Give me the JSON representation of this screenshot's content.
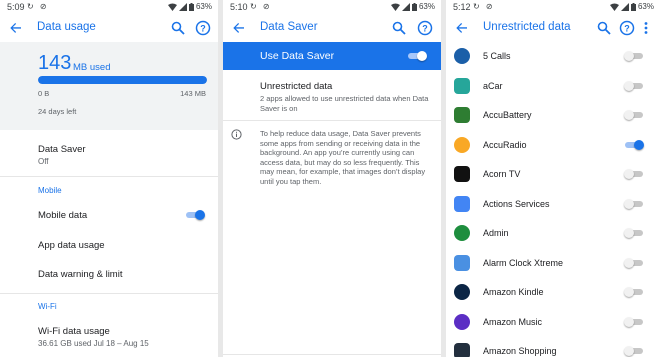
{
  "colors": {
    "accent": "#1a73e8",
    "bar_track": "#dadce0",
    "card": "#f1f3f4"
  },
  "status": [
    {
      "time": "5:09",
      "icons": "↻ ⊘",
      "battery": "63%"
    },
    {
      "time": "5:10",
      "icons": "↻ ⊘",
      "battery": "63%"
    },
    {
      "time": "5:12",
      "icons": "↻ ⊘",
      "battery": "63%"
    }
  ],
  "data_usage": {
    "title": "Data usage",
    "amount": "143",
    "unit": "MB used",
    "progress_fraction": 1.0,
    "range_min": "0 B",
    "range_max": "143 MB",
    "days_left": "24 days left",
    "items": [
      {
        "label": "Data Saver",
        "sub": "Off"
      },
      {
        "section": "Mobile"
      },
      {
        "label": "Mobile data",
        "toggle": true
      },
      {
        "label": "App data usage"
      },
      {
        "label": "Data warning & limit"
      },
      {
        "section": "Wi-Fi"
      },
      {
        "label": "Wi-Fi data usage",
        "sub": "36.61 GB used Jul 18 – Aug 15"
      }
    ]
  },
  "data_saver": {
    "title": "Data Saver",
    "use_label": "Use Data Saver",
    "use_on": true,
    "unrestricted_title": "Unrestricted data",
    "unrestricted_sub": "2 apps allowed to use unrestricted data when Data Saver is on",
    "info": "To help reduce data usage, Data Saver prevents some apps from sending or receiving data in the background. An app you’re currently using can access data, but may do so less frequently. This may mean, for example, that images don’t display until you tap them."
  },
  "unrestricted": {
    "title": "Unrestricted data",
    "apps": [
      {
        "name": "5 Calls",
        "on": false,
        "icon": "five-calls-icon",
        "color": "#1b5fa8"
      },
      {
        "name": "aCar",
        "on": false,
        "icon": "acar-icon",
        "color": "#26a69a"
      },
      {
        "name": "AccuBattery",
        "on": false,
        "icon": "accubattery-icon",
        "color": "#2e7d32"
      },
      {
        "name": "AccuRadio",
        "on": true,
        "icon": "accuradio-icon",
        "color": "#f9a825"
      },
      {
        "name": "Acorn TV",
        "on": false,
        "icon": "acorn-tv-icon",
        "color": "#111111"
      },
      {
        "name": "Actions Services",
        "on": false,
        "icon": "actions-services-icon",
        "color": "#4285f4"
      },
      {
        "name": "Admin",
        "on": false,
        "icon": "admin-icon",
        "color": "#1e8e3e"
      },
      {
        "name": "Alarm Clock Xtreme",
        "on": false,
        "icon": "alarm-clock-icon",
        "color": "#4a90e2"
      },
      {
        "name": "Amazon Kindle",
        "on": false,
        "icon": "kindle-icon",
        "color": "#0b2545"
      },
      {
        "name": "Amazon Music",
        "on": false,
        "icon": "amazon-music-icon",
        "color": "#5b2ec4"
      },
      {
        "name": "Amazon Shopping",
        "on": false,
        "icon": "amazon-shopping-icon",
        "color": "#232f3e"
      }
    ]
  }
}
